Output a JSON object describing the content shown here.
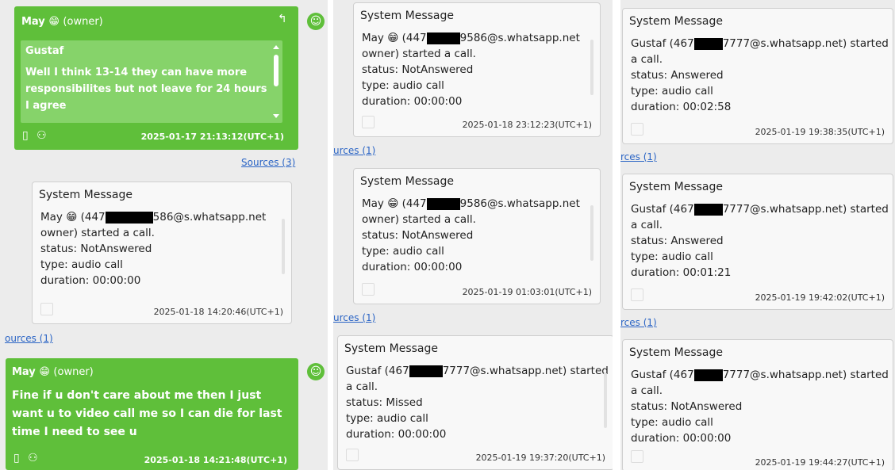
{
  "panel1": {
    "owner_msg_1": {
      "sender": "May",
      "emoji": "😁",
      "owner_tag": "(owner)",
      "reply_icon": "reply-icon",
      "quote_sender": "Gustaf",
      "quote_text": "Well I think 13-14 they can have more responsibilites but not leave for 24 hours I agree",
      "timestamp": "2025-01-17 21:13:12(UTC+1)"
    },
    "sources_1": "Sources (3)",
    "system_msg": {
      "title": "System Message",
      "caller_name": "May",
      "caller_emoji": "😁",
      "caller_prefix": "(447",
      "caller_suffix": "586@s.whatsapp.net",
      "line2": "owner) started a call.",
      "status": "status: NotAnswered",
      "type": "type: audio call",
      "duration": "duration: 00:00:00",
      "timestamp": "2025-01-18 14:20:46(UTC+1)"
    },
    "sources_2": "ources (1)",
    "owner_msg_2": {
      "sender": "May",
      "emoji": "😁",
      "owner_tag": "(owner)",
      "text": "Fine if u don't care about me then I just want u to video call me so I can die for last time I need to see u",
      "timestamp": "2025-01-18 14:21:48(UTC+1)"
    }
  },
  "panel2": {
    "cards": [
      {
        "title": "System Message",
        "line1_a": "May",
        "emoji": "😁",
        "line1_b": "(447",
        "line1_c": "9586@s.whatsapp.net",
        "line2": "owner) started a call.",
        "status": "status: NotAnswered",
        "type": "type: audio call",
        "duration": "duration: 00:00:00",
        "timestamp": "2025-01-18 23:12:23(UTC+1)"
      },
      {
        "title": "System Message",
        "line1_a": "May",
        "emoji": "😁",
        "line1_b": "(447",
        "line1_c": "9586@s.whatsapp.net",
        "line2": "owner) started a call.",
        "status": "status: NotAnswered",
        "type": "type: audio call",
        "duration": "duration: 00:00:00",
        "timestamp": "2025-01-19 01:03:01(UTC+1)"
      },
      {
        "title": "System Message",
        "line1_a": "Gustaf (467",
        "line1_c": "7777@s.whatsapp.net) started",
        "line2": "a call.",
        "status": "status: Missed",
        "type": "type: audio call",
        "duration": "duration: 00:00:00",
        "timestamp": "2025-01-19 19:37:20(UTC+1)"
      }
    ],
    "sources": [
      "urces (1)",
      "urces (1)"
    ]
  },
  "panel3": {
    "cards": [
      {
        "title": "System Message",
        "line1_a": "Gustaf (467",
        "line1_c": "7777@s.whatsapp.net) started",
        "line2": "a call.",
        "status": "status: Answered",
        "type": "type: audio call",
        "duration": "duration: 00:02:58",
        "timestamp": "2025-01-19 19:38:35(UTC+1)"
      },
      {
        "title": "System Message",
        "line1_a": "Gustaf (467",
        "line1_c": "7777@s.whatsapp.net) started",
        "line2": "a call.",
        "status": "status: Answered",
        "type": "type: audio call",
        "duration": "duration: 00:01:21",
        "timestamp": "2025-01-19 19:42:02(UTC+1)"
      },
      {
        "title": "System Message",
        "line1_a": "Gustaf (467",
        "line1_c": "7777@s.whatsapp.net) started",
        "line2": "a call.",
        "status": "status: NotAnswered",
        "type": "type: audio call",
        "duration": "duration: 00:00:00",
        "timestamp": "2025-01-19 19:44:27(UTC+1)"
      }
    ],
    "sources": [
      "rces (1)",
      "rces (1)"
    ]
  },
  "colors": {
    "owner_bubble": "#5fbf3a",
    "quote_box": "#86d36a",
    "link": "#2a64c5",
    "redaction": "#000000"
  },
  "icons": [
    "reply-icon",
    "avatar-icon",
    "phone-icon",
    "contacts-icon"
  ]
}
